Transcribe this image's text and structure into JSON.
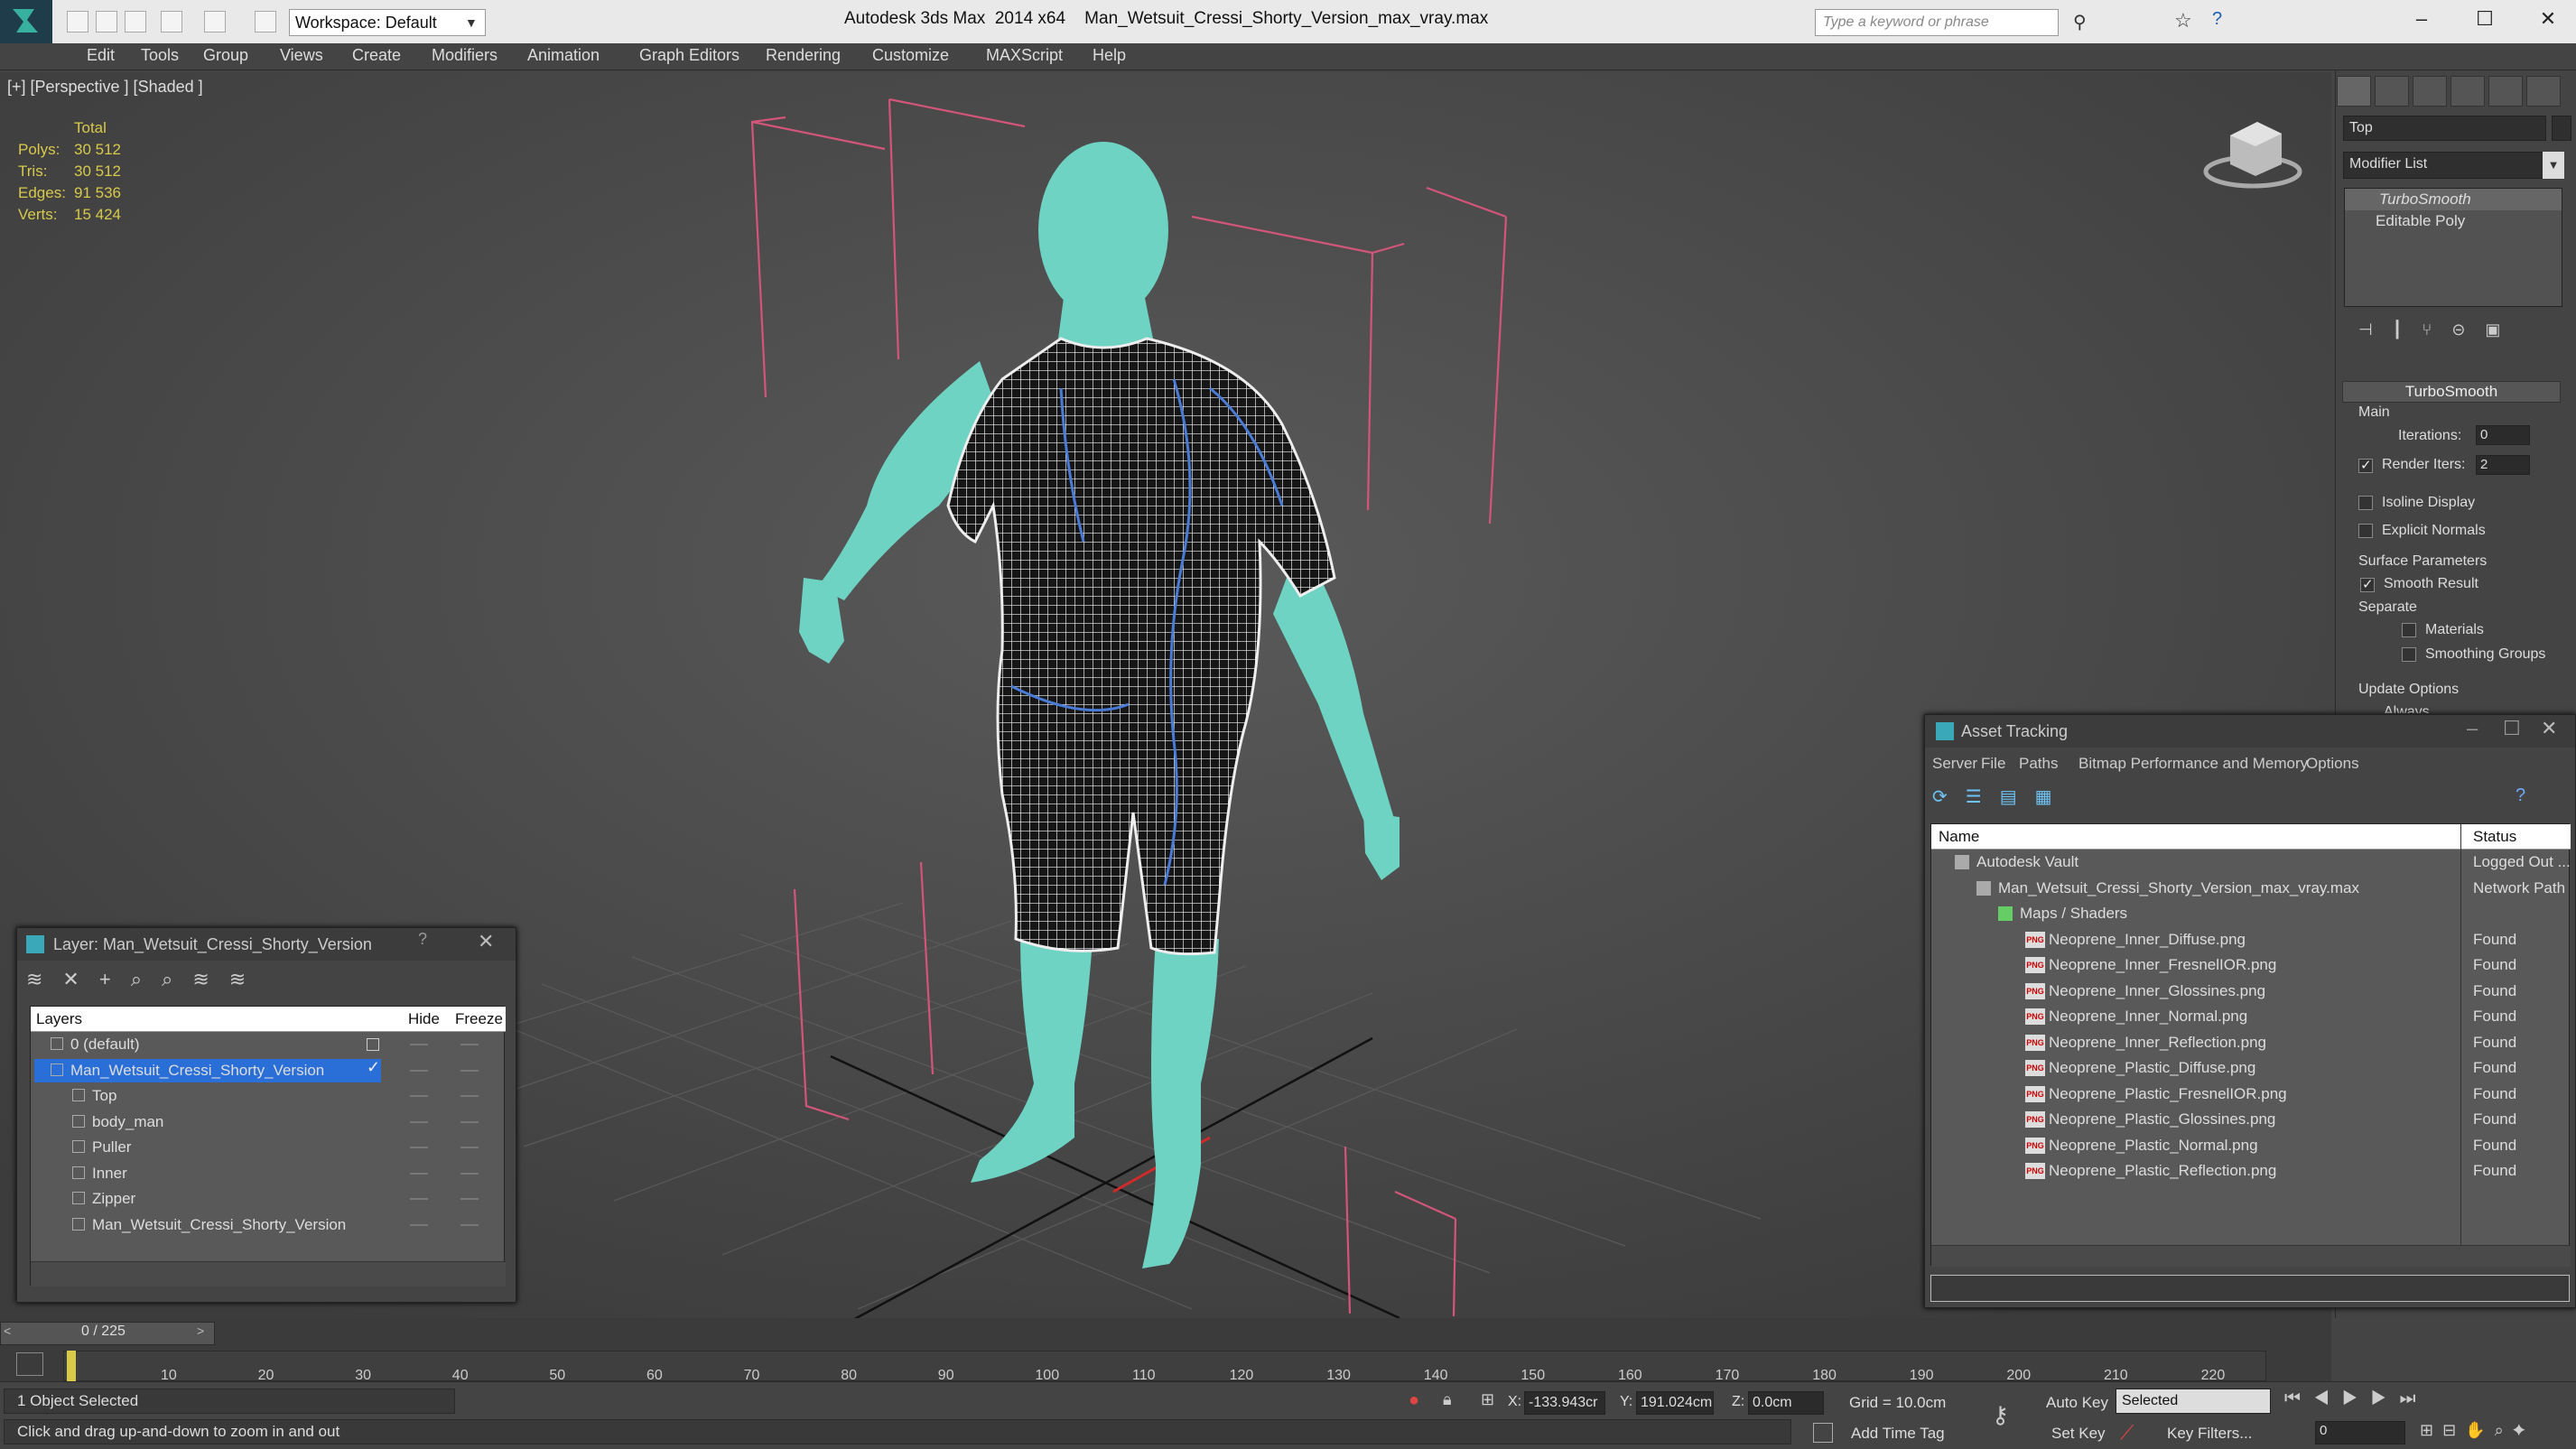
{
  "window": {
    "app_title": "Autodesk 3ds Max  2014 x64",
    "file_title": "Man_Wetsuit_Cressi_Shorty_Version_max_vray.max",
    "workspace": "Workspace: Default",
    "search_placeholder": "Type a keyword or phrase"
  },
  "menus": [
    "Edit",
    "Tools",
    "Group",
    "Views",
    "Create",
    "Modifiers",
    "Animation",
    "Graph Editors",
    "Rendering",
    "Customize",
    "MAXScript",
    "Help"
  ],
  "viewport": {
    "label": "[+] [Perspective ] [Shaded ]",
    "stats_header": "Total",
    "stats": [
      {
        "k": "Polys:",
        "v": "30 512"
      },
      {
        "k": "Tris:",
        "v": "30 512"
      },
      {
        "k": "Edges:",
        "v": "91 536"
      },
      {
        "k": "Verts:",
        "v": "15 424"
      }
    ]
  },
  "command_panel": {
    "object_name": "Top",
    "modifier_list": "Modifier List",
    "stack": [
      "TurboSmooth",
      "Editable Poly"
    ],
    "rollout_title": "TurboSmooth",
    "main_label": "Main",
    "iterations_label": "Iterations:",
    "iterations": "0",
    "render_iters_label": "Render Iters:",
    "render_iters": "2",
    "isoline": "Isoline Display",
    "explicit": "Explicit Normals",
    "surface_params": "Surface Parameters",
    "smooth_result": "Smooth Result",
    "separate": "Separate",
    "materials": "Materials",
    "smoothing_groups": "Smoothing Groups",
    "update_options": "Update Options",
    "always": "Always"
  },
  "layer_dialog": {
    "title": "Layer: Man_Wetsuit_Cressi_Shorty_Version",
    "help": "?",
    "col_layers": "Layers",
    "col_hide": "Hide",
    "col_freeze": "Freeze",
    "rows": [
      "0 (default)",
      "Man_Wetsuit_Cressi_Shorty_Version",
      "Top",
      "body_man",
      "Puller",
      "Inner",
      "Zipper",
      "Man_Wetsuit_Cressi_Shorty_Version"
    ]
  },
  "asset_tracking": {
    "title": "Asset Tracking",
    "menus": [
      "Server",
      "File",
      "Paths",
      "Bitmap Performance and Memory",
      "Options"
    ],
    "col_name": "Name",
    "col_status": "Status",
    "rows": [
      {
        "name": "Autodesk Vault",
        "status": "Logged Out ..."
      },
      {
        "name": "Man_Wetsuit_Cressi_Shorty_Version_max_vray.max",
        "status": "Network Path"
      },
      {
        "name": "Maps / Shaders",
        "status": ""
      },
      {
        "name": "Neoprene_Inner_Diffuse.png",
        "status": "Found"
      },
      {
        "name": "Neoprene_Inner_FresnelIOR.png",
        "status": "Found"
      },
      {
        "name": "Neoprene_Inner_Glossines.png",
        "status": "Found"
      },
      {
        "name": "Neoprene_Inner_Normal.png",
        "status": "Found"
      },
      {
        "name": "Neoprene_Inner_Reflection.png",
        "status": "Found"
      },
      {
        "name": "Neoprene_Plastic_Diffuse.png",
        "status": "Found"
      },
      {
        "name": "Neoprene_Plastic_FresnelIOR.png",
        "status": "Found"
      },
      {
        "name": "Neoprene_Plastic_Glossines.png",
        "status": "Found"
      },
      {
        "name": "Neoprene_Plastic_Normal.png",
        "status": "Found"
      },
      {
        "name": "Neoprene_Plastic_Reflection.png",
        "status": "Found"
      }
    ]
  },
  "timeline": {
    "frame": "0 / 225",
    "ticks": [
      "10",
      "20",
      "30",
      "40",
      "50",
      "60",
      "70",
      "80",
      "90",
      "100",
      "110",
      "120",
      "130",
      "140",
      "150",
      "160",
      "170",
      "180",
      "190",
      "200",
      "210",
      "220"
    ]
  },
  "status": {
    "selected": "1 Object Selected",
    "prompt": "Click and drag up-and-down to zoom in and out",
    "x_label": "X:",
    "x": "-133.943cr",
    "y_label": "Y:",
    "y": "191.024cm",
    "z_label": "Z:",
    "z": "0.0cm",
    "grid": "Grid = 10.0cm",
    "add_time_tag": "Add Time Tag",
    "auto_key": "Auto Key",
    "set_key": "Set Key",
    "key_mode": "Selected",
    "key_filters": "Key Filters...",
    "frame_field": "0"
  },
  "colors": {
    "skin": "#6ed3c3",
    "wire": "#ffffff",
    "seam": "#4a7bd6",
    "box": "#d2557a",
    "stats": "#d8c94a"
  }
}
